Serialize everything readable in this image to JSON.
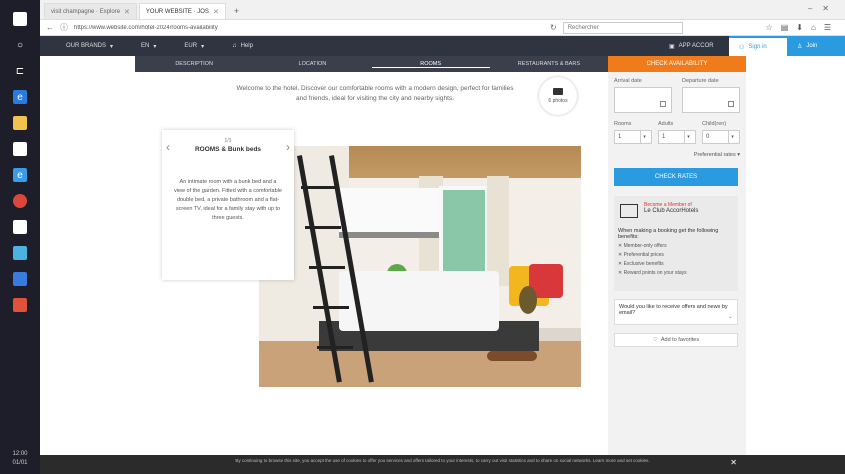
{
  "browser": {
    "tabs": [
      {
        "title": "visit champagne · Explore"
      },
      {
        "title": "YOUR WEBSITE · JOS"
      }
    ],
    "url": "https://www.website.com/hotel-2024/rooms-availability",
    "search_placeholder": "Rechercher"
  },
  "topnav": {
    "items": [
      "OUR BRANDS",
      "EN",
      "EUR",
      "Help"
    ],
    "app_label": "APP ACCOR",
    "signin_label": "Sign in",
    "join_label": "Join"
  },
  "subnav": {
    "tabs": [
      "DESCRIPTION",
      "LOCATION",
      "ROOMS",
      "RESTAURANTS & BARS"
    ],
    "active": 2
  },
  "booking": {
    "header": "CHECK AVAILABILITY",
    "arrival_label": "Arrival date",
    "departure_label": "Departure date",
    "rooms_label": "Rooms",
    "adults_label": "Adults",
    "children_label": "Child(ren)",
    "rooms_value": "1",
    "adults_value": "1",
    "children_value": "0",
    "ages_link": "Preferential rates",
    "check_button": "CHECK RATES",
    "promo_tag": "Become a Member of",
    "promo_title": "Le Club AccorHotels",
    "promo_text": "When making a booking get the following benefits:",
    "benefits": [
      "Member-only offers",
      "Preferential prices",
      "Exclusive benefits",
      "Reward points on your stays"
    ],
    "message_text": "Would you like to receive offers and news by email?",
    "fav_button": "Add to favorites"
  },
  "main": {
    "intro": "Welcome to the hotel. Discover our comfortable rooms with a modern design, perfect for families and friends, ideal for visiting the city and nearby sights.",
    "photos_label": "6 photos",
    "room_count": "1/3",
    "room_title": "ROOMS & Bunk beds",
    "room_desc": "An intimate room with a bunk bed and a view of the garden. Fitted with a comfortable double bed, a private bathroom and a flat-screen TV, ideal for a family stay with up to three guests."
  },
  "cookie": {
    "text": "By continuing to browse this site, you accept the use of cookies to offer you services and offers tailored to your interests, to carry out visit statistics and to share on social networks. Learn more and set cookies."
  }
}
